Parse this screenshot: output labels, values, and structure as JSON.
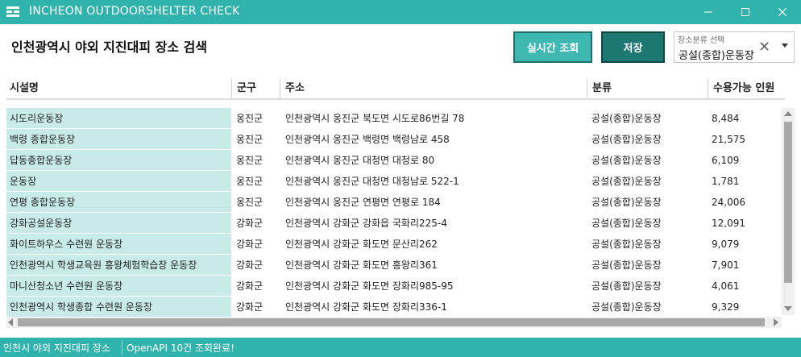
{
  "window": {
    "title": "INCHEON OUTDOORSHELTER CHECK",
    "minimize_icon": "minimize-icon",
    "maximize_icon": "maximize-icon",
    "close_icon": "close-icon"
  },
  "header": {
    "page_title": "인천광역시 야외 지진대피 장소 검색",
    "search_button": "실시간 조회",
    "save_button": "저장",
    "category_select": {
      "hint": "장소분류 선택",
      "value": "공설(종합)운동장",
      "clear_glyph": "✕"
    }
  },
  "table": {
    "columns": [
      "시설명",
      "군구",
      "주소",
      "분류",
      "수용가능 인원"
    ],
    "rows": [
      {
        "name": "시도리운동장",
        "gungu": "옹진군",
        "address": "인천광역시 옹진군 북도면 시도로86번길 78",
        "category": "공설(종합)운동장",
        "capacity": "8,484"
      },
      {
        "name": "백령 종합운동장",
        "gungu": "옹진군",
        "address": "인천광역시 옹진군 백령면 백령남로 458",
        "category": "공설(종합)운동장",
        "capacity": "21,575"
      },
      {
        "name": "답동종합운동장",
        "gungu": "옹진군",
        "address": "인천광역시 옹진군 대청면 대청로 80",
        "category": "공설(종합)운동장",
        "capacity": "6,109"
      },
      {
        "name": "운동장",
        "gungu": "옹진군",
        "address": "인천광역시 옹진군 대청면 대청남로 522-1",
        "category": "공설(종합)운동장",
        "capacity": "1,781"
      },
      {
        "name": "연평 종합운동장",
        "gungu": "옹진군",
        "address": "인천광역시 옹진군 연평면 연평로 184",
        "category": "공설(종합)운동장",
        "capacity": "24,006"
      },
      {
        "name": "강화공설운동장",
        "gungu": "강화군",
        "address": "인천광역시 강화군 강화읍 국화리225-4",
        "category": "공설(종합)운동장",
        "capacity": "12,091"
      },
      {
        "name": "화이트하우스 수련원 운동장",
        "gungu": "강화군",
        "address": "인천광역시 강화군 화도면 문산리262",
        "category": "공설(종합)운동장",
        "capacity": "9,079"
      },
      {
        "name": "인천광역시 학생교육원 흥왕체험학습장 운동장",
        "gungu": "강화군",
        "address": "인천광역시 강화군 화도면 흥왕리361",
        "category": "공설(종합)운동장",
        "capacity": "7,901"
      },
      {
        "name": "마니산청소년 수련원 운동장",
        "gungu": "강화군",
        "address": "인천광역시 강화군 화도면 장화리985-95",
        "category": "공설(종합)운동장",
        "capacity": "4,061"
      },
      {
        "name": "인천광역시 학생종합 수련원 운동장",
        "gungu": "강화군",
        "address": "인천광역시 강화군 화도면 장화리336-1",
        "category": "공설(종합)운동장",
        "capacity": "9,329"
      }
    ]
  },
  "status": {
    "left": "인천시 야외 지진대피 장소",
    "right": "OpenAPI 10건 조회완료!"
  },
  "colors": {
    "accent": "#31b3ad",
    "row_highlight": "#c8ebea",
    "save_button": "#1d7872"
  }
}
